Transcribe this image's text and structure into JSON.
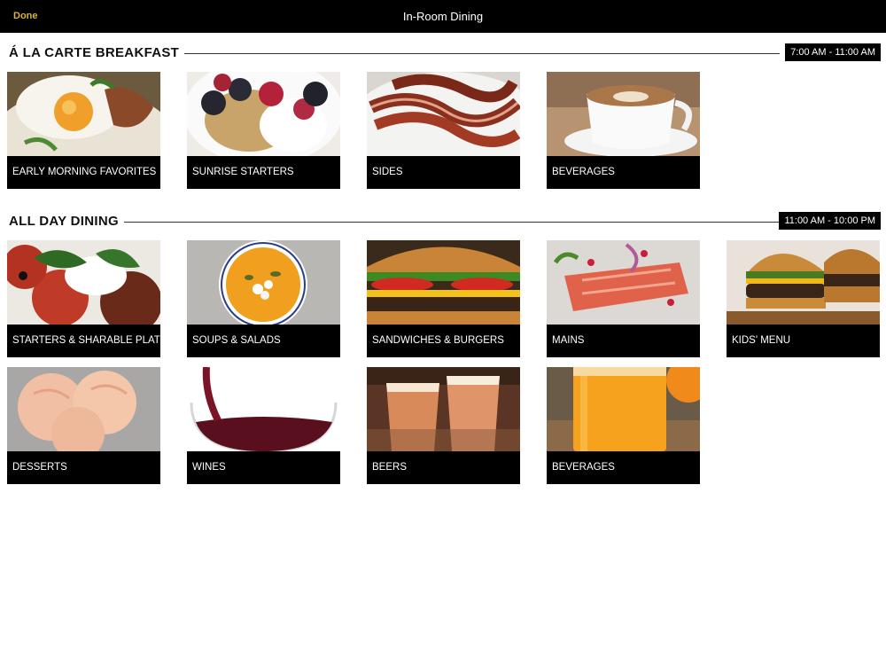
{
  "header": {
    "done_label": "Done",
    "title": "In-Room Dining"
  },
  "sections": [
    {
      "title": "Á LA CARTE BREAKFAST",
      "hours": "7:00 AM - 11:00 AM",
      "items": [
        {
          "label": "EARLY MORNING FAVORITES",
          "image": "fried-egg-plate"
        },
        {
          "label": "SUNRISE STARTERS",
          "image": "granola-berries-bowl"
        },
        {
          "label": "SIDES",
          "image": "bacon-strips"
        },
        {
          "label": "BEVERAGES",
          "image": "latte-cup"
        }
      ]
    },
    {
      "title": "ALL DAY DINING",
      "hours": "11:00 AM - 10:00 PM",
      "items": [
        {
          "label": "STARTERS & SHARABLE PLATES",
          "image": "caprese-plate"
        },
        {
          "label": "SOUPS & SALADS",
          "image": "pumpkin-soup"
        },
        {
          "label": "SANDWICHES & BURGERS",
          "image": "cheeseburger"
        },
        {
          "label": "MAINS",
          "image": "salmon-fillet"
        },
        {
          "label": "KIDS' MENU",
          "image": "sliders"
        },
        {
          "label": "DESSERTS",
          "image": "ice-cream-scoops"
        },
        {
          "label": "WINES",
          "image": "red-wine-glass"
        },
        {
          "label": "BEERS",
          "image": "beer-glasses"
        },
        {
          "label": "BEVERAGES",
          "image": "orange-juice"
        }
      ]
    }
  ]
}
